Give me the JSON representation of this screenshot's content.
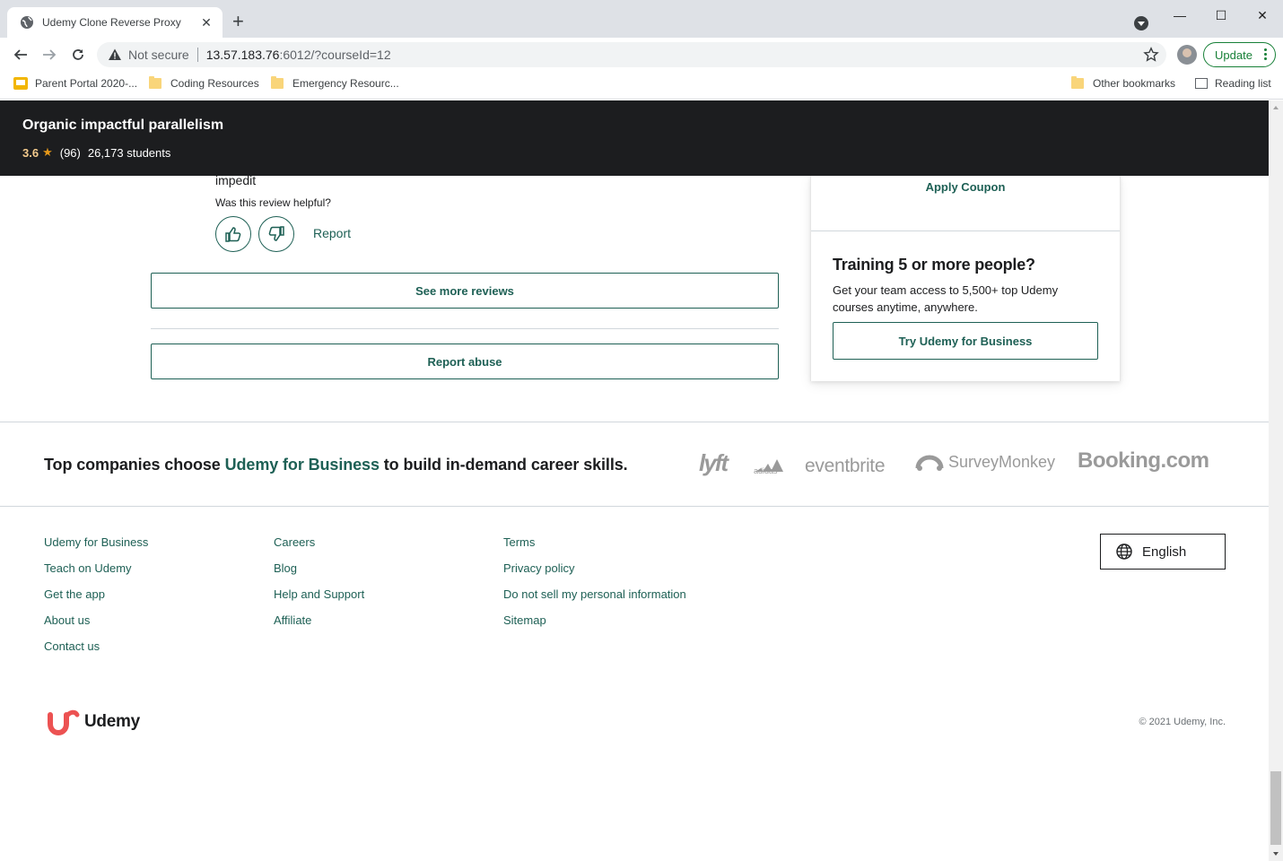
{
  "browser": {
    "tab_title": "Udemy Clone Reverse Proxy",
    "not_secure": "Not secure",
    "url_host": "13.57.183.76",
    "url_rest": ":6012/?courseId=12",
    "update_label": "Update",
    "bookmarks": [
      {
        "label": "Parent Portal 2020-..."
      },
      {
        "label": "Coding Resources"
      },
      {
        "label": "Emergency Resourc..."
      }
    ],
    "other_bookmarks": "Other bookmarks",
    "reading_list": "Reading list"
  },
  "course_header": {
    "title": "Organic impactful parallelism",
    "rating": "3.6",
    "rating_count": "(96)",
    "students": "26,173 students",
    "star_color": "#e59819"
  },
  "review": {
    "text_tail": "impedit",
    "helpful_prompt": "Was this review helpful?",
    "report_label": "Report"
  },
  "reviews_section": {
    "see_more_label": "See more reviews",
    "report_abuse_label": "Report abuse"
  },
  "sidebar": {
    "apply_coupon": "Apply Coupon",
    "training_title": "Training 5 or more people?",
    "training_desc": "Get your team access to 5,500+ top Udemy courses anytime, anywhere.",
    "try_business": "Try Udemy for Business"
  },
  "companies_banner": {
    "prefix": "Top companies choose ",
    "highlight": "Udemy for Business",
    "suffix": " to build in-demand career skills.",
    "logos": [
      "lyft",
      "adidas",
      "eventbrite",
      "SurveyMonkey",
      "Booking.com"
    ]
  },
  "footer": {
    "col1": [
      "Udemy for Business",
      "Teach on Udemy",
      "Get the app",
      "About us",
      "Contact us"
    ],
    "col2": [
      "Careers",
      "Blog",
      "Help and Support",
      "Affiliate"
    ],
    "col3": [
      "Terms",
      "Privacy policy",
      "Do not sell my personal information",
      "Sitemap"
    ],
    "language": "English",
    "brand": "Udemy",
    "copyright": "© 2021 Udemy, Inc."
  },
  "colors": {
    "accent": "#1e6055",
    "header_bg": "#1c1d1f",
    "brand_red": "#ec5252"
  }
}
